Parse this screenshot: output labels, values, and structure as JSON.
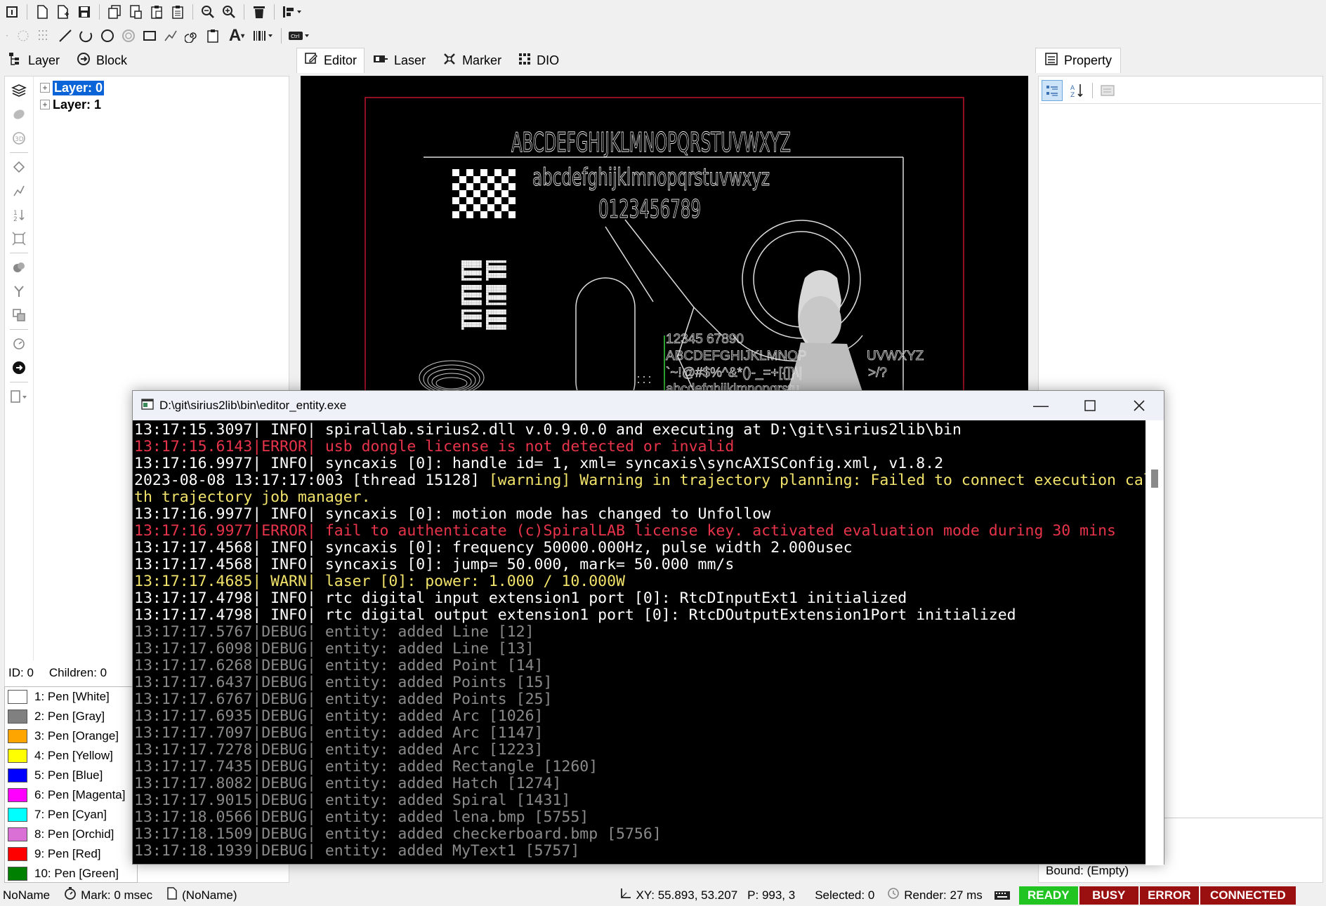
{
  "toolbar1": {
    "icons": [
      "info-icon",
      "new-file-icon",
      "new-file2-icon",
      "save-icon",
      "copy-icon",
      "paste-icon",
      "clipboard-icon",
      "clipboard2-icon",
      "zoom-in-icon",
      "zoom-out-icon",
      "delete-icon",
      "align-icon"
    ]
  },
  "toolbar2": {
    "icons": [
      "point-icon",
      "points-icon",
      "line-icon",
      "arc-icon",
      "circle-icon",
      "trepan-icon",
      "rectangle-icon",
      "spline-icon",
      "spiral-icon",
      "clipboard-icon",
      "text-icon",
      "barcode-icon",
      "ctrl-icon"
    ]
  },
  "left_tabs": [
    {
      "label": "Layer"
    },
    {
      "label": "Block"
    }
  ],
  "center_tabs": [
    {
      "label": "Editor"
    },
    {
      "label": "Laser"
    },
    {
      "label": "Marker"
    },
    {
      "label": "DIO"
    }
  ],
  "right_tabs": [
    {
      "label": "Property"
    }
  ],
  "tree": {
    "items": [
      {
        "label": "Layer: 0"
      },
      {
        "label": "Layer: 1"
      }
    ]
  },
  "id_bar": {
    "id": "ID: 0",
    "children": "Children: 0"
  },
  "pens": [
    {
      "label": "1: Pen [White]",
      "color": "#ffffff"
    },
    {
      "label": "2: Pen [Gray]",
      "color": "#808080"
    },
    {
      "label": "3: Pen [Orange]",
      "color": "#ffa500"
    },
    {
      "label": "4: Pen [Yellow]",
      "color": "#ffff00"
    },
    {
      "label": "5: Pen [Blue]",
      "color": "#0000ff"
    },
    {
      "label": "6: Pen [Magenta]",
      "color": "#ff00ff"
    },
    {
      "label": "7: Pen [Cyan]",
      "color": "#00ffff"
    },
    {
      "label": "8: Pen [Orchid]",
      "color": "#da70d6"
    },
    {
      "label": "9: Pen [Red]",
      "color": "#ff0000"
    },
    {
      "label": "10: Pen [Green]",
      "color": "#008000"
    }
  ],
  "canvas": {
    "upper": "ABCDEFGHIJKLMNOPQRSTUVWXYZ",
    "lower": "abcdefghijklmnopqrstuvwxyz",
    "digits": "0123456789",
    "g_digits": "12345 67890",
    "g_upper": "ABCDEFGHIJKLMNOP",
    "g_upper_tail": "UVWXYZ",
    "g_symbols": "`~!@#$%^&*()-_=+[{]}\\|",
    "g_symbols_tail": ">/?",
    "g_lower": "abcdefghijklmnopqrstu"
  },
  "console": {
    "title": "D:\\git\\sirius2lib\\bin\\editor_entity.exe",
    "lines": [
      {
        "text": "13:17:15.3097| INFO| spirallab.sirius2.dll v.0.9.0.0 and executing at D:\\git\\sirius2lib\\bin",
        "color": "#ffffff"
      },
      {
        "text": "13:17:15.6143|ERROR| usb dongle license is not detected or invalid",
        "color": "#e8344a"
      },
      {
        "text": "13:17:16.9977| INFO| syncaxis [0]: handle id= 1, xml= syncaxis\\syncAXISConfig.xml, v1.8.2",
        "color": "#ffffff"
      },
      {
        "text": "2023-08-08 13:17:17:003 [thread 15128] [warning] Warning in trajectory planning: Failed to connect execution callback wi",
        "color": "#ffffff",
        "warn_from": "[warning]"
      },
      {
        "text": "th trajectory job manager.",
        "color": "#f2e36b"
      },
      {
        "text": "13:17:16.9977| INFO| syncaxis [0]: motion mode has changed to Unfollow",
        "color": "#ffffff"
      },
      {
        "text": "13:17:16.9977|ERROR| fail to authenticate (c)SpiralLAB license key. activated evaluation mode during 30 mins",
        "color": "#e8344a"
      },
      {
        "text": "13:17:17.4568| INFO| syncaxis [0]: frequency 50000.000Hz, pulse width 2.000usec",
        "color": "#ffffff"
      },
      {
        "text": "13:17:17.4568| INFO| syncaxis [0]: jump= 50.000, mark= 50.000 mm/s",
        "color": "#ffffff"
      },
      {
        "text": "13:17:17.4685| WARN| laser [0]: power: 1.000 / 10.000W",
        "color": "#f2e36b"
      },
      {
        "text": "13:17:17.4798| INFO| rtc digital input extension1 port [0]: RtcDInputExt1 initialized",
        "color": "#ffffff"
      },
      {
        "text": "13:17:17.4798| INFO| rtc digital output extension1 port [0]: RtcDOutputExtension1Port initialized",
        "color": "#ffffff"
      },
      {
        "text": "13:17:17.5767|DEBUG| entity: added Line [12]",
        "color": "#8a8a8a"
      },
      {
        "text": "13:17:17.6098|DEBUG| entity: added Line [13]",
        "color": "#8a8a8a"
      },
      {
        "text": "13:17:17.6268|DEBUG| entity: added Point [14]",
        "color": "#8a8a8a"
      },
      {
        "text": "13:17:17.6437|DEBUG| entity: added Points [15]",
        "color": "#8a8a8a"
      },
      {
        "text": "13:17:17.6767|DEBUG| entity: added Points [25]",
        "color": "#8a8a8a"
      },
      {
        "text": "13:17:17.6935|DEBUG| entity: added Arc [1026]",
        "color": "#8a8a8a"
      },
      {
        "text": "13:17:17.7097|DEBUG| entity: added Arc [1147]",
        "color": "#8a8a8a"
      },
      {
        "text": "13:17:17.7278|DEBUG| entity: added Arc [1223]",
        "color": "#8a8a8a"
      },
      {
        "text": "13:17:17.7435|DEBUG| entity: added Rectangle [1260]",
        "color": "#8a8a8a"
      },
      {
        "text": "13:17:17.8082|DEBUG| entity: added Hatch [1274]",
        "color": "#8a8a8a"
      },
      {
        "text": "13:17:17.9015|DEBUG| entity: added Spiral [1431]",
        "color": "#8a8a8a"
      },
      {
        "text": "13:17:18.0566|DEBUG| entity: added lena.bmp [5755]",
        "color": "#8a8a8a"
      },
      {
        "text": "13:17:18.1509|DEBUG| entity: added checkerboard.bmp [5756]",
        "color": "#8a8a8a"
      },
      {
        "text": "13:17:18.1939|DEBUG| entity: added MyText1 [5757]",
        "color": "#8a8a8a"
      }
    ]
  },
  "property": {
    "bound": "Bound: (Empty)"
  },
  "status": {
    "name": "NoName",
    "mark": "Mark: 0 msec",
    "file": "(NoName)",
    "xy": "XY: 55.893, 53.207",
    "p": "P: 993, 3",
    "selected": "Selected: 0",
    "render": "Render: 27 ms",
    "ready": "READY",
    "busy": "BUSY",
    "error": "ERROR",
    "connected": "CONNECTED"
  },
  "colors": {
    "ready": "#22c422",
    "busy": "#9a1010",
    "error": "#9a1010",
    "connected": "#9a1010",
    "selection": "#0a64d8",
    "canvas_bg": "#000000",
    "canvas_frame": "#c0142c",
    "green_text": "#3ad43a"
  }
}
